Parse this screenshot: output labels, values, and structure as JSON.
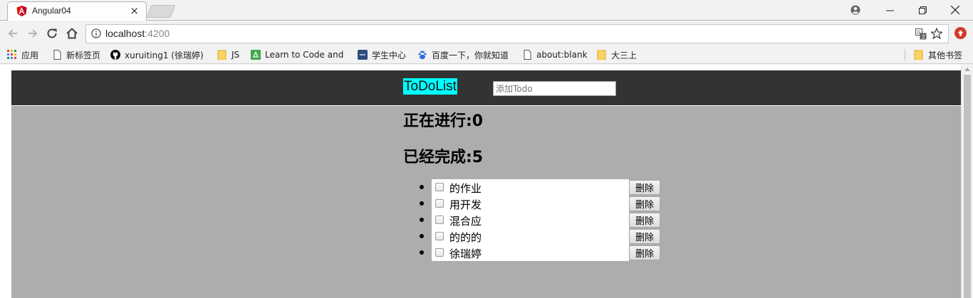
{
  "browser": {
    "tab_title": "Angular04",
    "tab_close": "×",
    "url_host": "localhost",
    "url_port": ":4200",
    "bookmarks": [
      {
        "label": "应用",
        "icon": "apps-grid-icon"
      },
      {
        "label": "新标签页",
        "icon": "page-icon"
      },
      {
        "label": "xuruiting1 (徐瑞婷)",
        "icon": "github-icon"
      },
      {
        "label": "JS",
        "icon": "folder-icon"
      },
      {
        "label": "Learn to Code and",
        "icon": "fcc-icon"
      },
      {
        "label": "学生中心",
        "icon": "student-center-icon"
      },
      {
        "label": "百度一下，你就知道",
        "icon": "baidu-icon"
      },
      {
        "label": "about:blank",
        "icon": "page-icon"
      },
      {
        "label": "大三上",
        "icon": "folder-icon"
      }
    ],
    "other_bookmarks": "其他书签"
  },
  "app": {
    "logo": "ToDoList",
    "input_placeholder": "添加Todo",
    "in_progress_label": "正在进行:0",
    "done_label": "已经完成:5",
    "delete_label": "删除",
    "todos": [
      {
        "text": "的作业",
        "checked": false
      },
      {
        "text": "用开发",
        "checked": false
      },
      {
        "text": "混合应",
        "checked": false
      },
      {
        "text": "的的的",
        "checked": false
      },
      {
        "text": "徐瑞婷",
        "checked": false
      }
    ]
  },
  "colors": {
    "header_bg": "#333333",
    "body_bg": "#adadad",
    "logo_bg": "#00ffff"
  }
}
